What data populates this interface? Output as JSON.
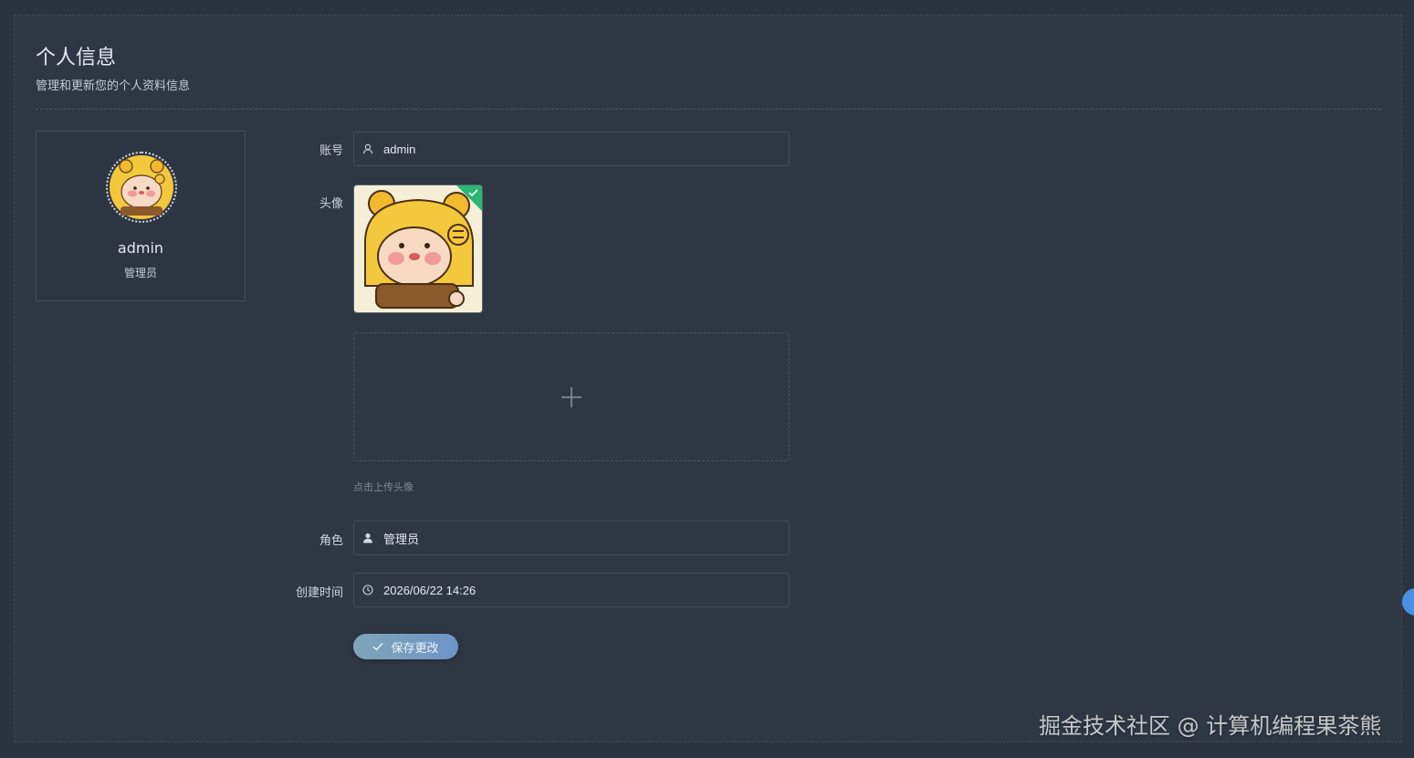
{
  "header": {
    "title": "个人信息",
    "subtitle": "管理和更新您的个人资料信息"
  },
  "profile_card": {
    "username": "admin",
    "role": "管理员"
  },
  "form": {
    "account_label": "账号",
    "account_value": "admin",
    "avatar_label": "头像",
    "upload_hint": "点击上传头像",
    "role_label": "角色",
    "role_value": "管理员",
    "created_label": "创建时间",
    "created_value": "2026/06/22 14:26",
    "save_label": "保存更改"
  },
  "watermark": "掘金技术社区 @ 计算机编程果茶熊",
  "icons": {
    "account": "user-outline-icon",
    "role": "user-solid-icon",
    "created": "clock-icon",
    "upload": "plus-icon",
    "save": "check-icon",
    "uploaded": "check-badge-icon"
  },
  "colors": {
    "background": "#2b3340",
    "panel": "#2f3744",
    "success": "#2bb673",
    "accent": "#6d94c7"
  }
}
